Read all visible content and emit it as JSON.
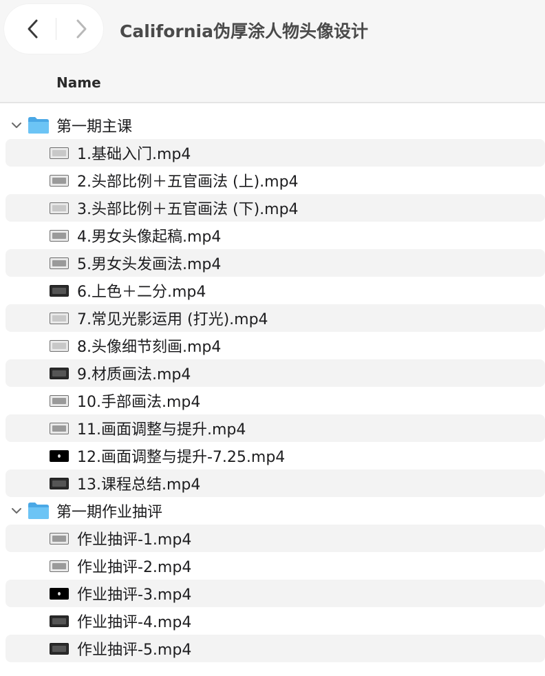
{
  "window": {
    "title": "California伪厚涂人物头像设计"
  },
  "column_header": {
    "name": "Name"
  },
  "folders": [
    {
      "name": "第一期主课",
      "files": [
        "1.基础入门.mp4",
        "2.头部比例＋五官画法 (上).mp4",
        "3.头部比例＋五官画法 (下).mp4",
        "4.男女头像起稿.mp4",
        "5.男女头发画法.mp4",
        "6.上色＋二分.mp4",
        "7.常见光影运用 (打光).mp4",
        "8.头像细节刻画.mp4",
        "9.材质画法.mp4",
        "10.手部画法.mp4",
        "11.画面调整与提升.mp4",
        "12.画面调整与提升-7.25.mp4",
        "13.课程总结.mp4"
      ]
    },
    {
      "name": "第一期作业抽评",
      "files": [
        "作业抽评-1.mp4",
        "作业抽评-2.mp4",
        "作业抽评-3.mp4",
        "作业抽评-4.mp4",
        "作业抽评-5.mp4"
      ]
    }
  ],
  "icons": {
    "back": "chevron-left-icon",
    "forward": "chevron-right-icon",
    "disclosure": "chevron-down-icon",
    "folder": "folder-icon",
    "file": "video-thumbnail-icon"
  },
  "colors": {
    "folder": "#5bb8ef",
    "row_stripe": "#f3f3f3"
  }
}
